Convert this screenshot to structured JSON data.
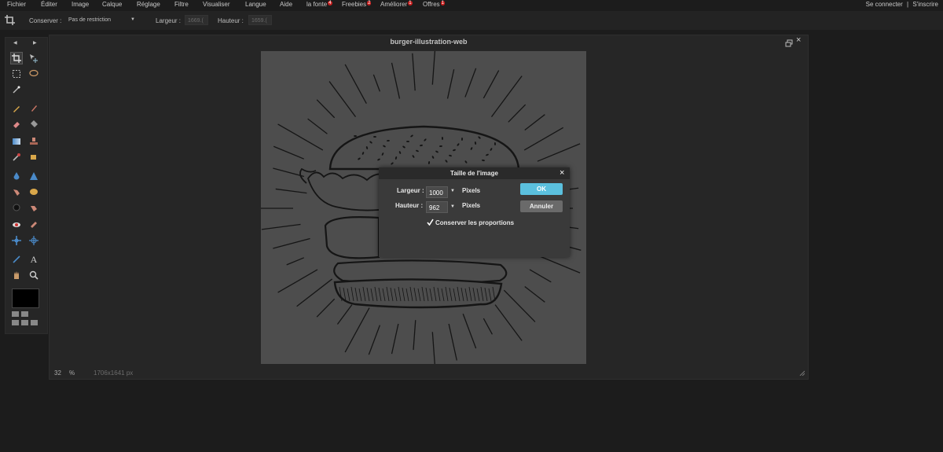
{
  "menu": {
    "items": [
      {
        "label": "Fichier"
      },
      {
        "label": "Éditer"
      },
      {
        "label": "Image"
      },
      {
        "label": "Calque"
      },
      {
        "label": "Réglage"
      },
      {
        "label": "Filtre"
      },
      {
        "label": "Visualiser"
      },
      {
        "label": "Langue"
      },
      {
        "label": "Aide"
      },
      {
        "label": "la fonte",
        "badge": "4"
      },
      {
        "label": "Freebies",
        "badge": "2"
      },
      {
        "label": "Améliorer",
        "badge": "1"
      },
      {
        "label": "Offres",
        "badge": "1"
      }
    ],
    "login": "Se connecter",
    "separator": "|",
    "signup": "S'inscrire"
  },
  "options": {
    "conserver_label": "Conserver :",
    "conserver_value": "Pas de restriction",
    "largeur_label": "Largeur :",
    "largeur_value": "1669.(",
    "hauteur_label": "Hauteur :",
    "hauteur_value": "1659.("
  },
  "document": {
    "title": "burger-illustration-web",
    "zoom": "32",
    "zoom_unit": "%",
    "dimensions": "1706x1641 px"
  },
  "colors": {
    "ok": "#5bc0de",
    "cancel": "#6a6a6a",
    "foreground": "#000000"
  },
  "dialog": {
    "title": "Taille de l'image",
    "largeur_label": "Largeur :",
    "largeur_value": "1000",
    "hauteur_label": "Hauteur :",
    "hauteur_value": "962",
    "unit": "Pixels",
    "keep_ratio_label": "Conserver les proportions",
    "ok_label": "OK",
    "cancel_label": "Annuler",
    "close": "×"
  }
}
